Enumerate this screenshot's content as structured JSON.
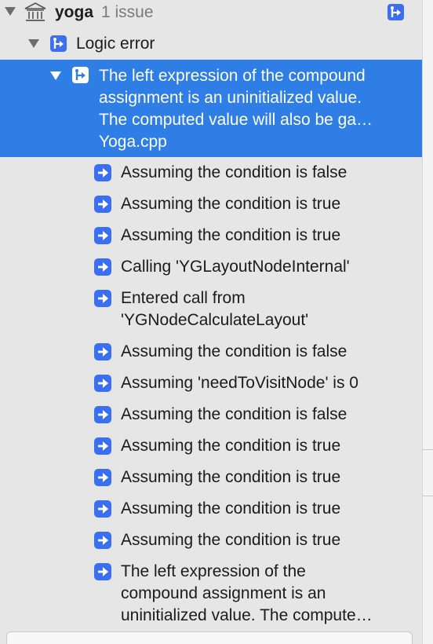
{
  "navigator": {
    "project": {
      "name": "yoga",
      "issue_count": "1 issue",
      "icon": "project-building-icon",
      "filter_icon": "issue-branch-icon"
    },
    "category": {
      "label": "Logic error",
      "icon": "issue-branch-icon"
    },
    "issue": {
      "lines": [
        "The left expression of the compound",
        "assignment is an uninitialized value.",
        "The computed value will also be ga…"
      ],
      "file": "Yoga.cpp",
      "icon": "issue-branch-icon"
    },
    "steps": [
      {
        "lines": [
          "Assuming the condition is false"
        ]
      },
      {
        "lines": [
          "Assuming the condition is true"
        ]
      },
      {
        "lines": [
          "Assuming the condition is true"
        ]
      },
      {
        "lines": [
          "Calling 'YGLayoutNodeInternal'"
        ]
      },
      {
        "lines": [
          "Entered call from",
          "'YGNodeCalculateLayout'"
        ]
      },
      {
        "lines": [
          "Assuming the condition is false"
        ]
      },
      {
        "lines": [
          "Assuming 'needToVisitNode' is 0"
        ]
      },
      {
        "lines": [
          "Assuming the condition is false"
        ]
      },
      {
        "lines": [
          "Assuming the condition is true"
        ]
      },
      {
        "lines": [
          "Assuming the condition is true"
        ]
      },
      {
        "lines": [
          "Assuming the condition is true"
        ]
      },
      {
        "lines": [
          "Assuming the condition is true"
        ]
      },
      {
        "lines": [
          "The left expression of the",
          "compound assignment is an",
          "uninitialized value. The compute…"
        ]
      }
    ],
    "step_icon": "arrow-right-icon"
  },
  "colors": {
    "selection": "#2f7ee6",
    "icon_blue": "#3a6ff2"
  }
}
